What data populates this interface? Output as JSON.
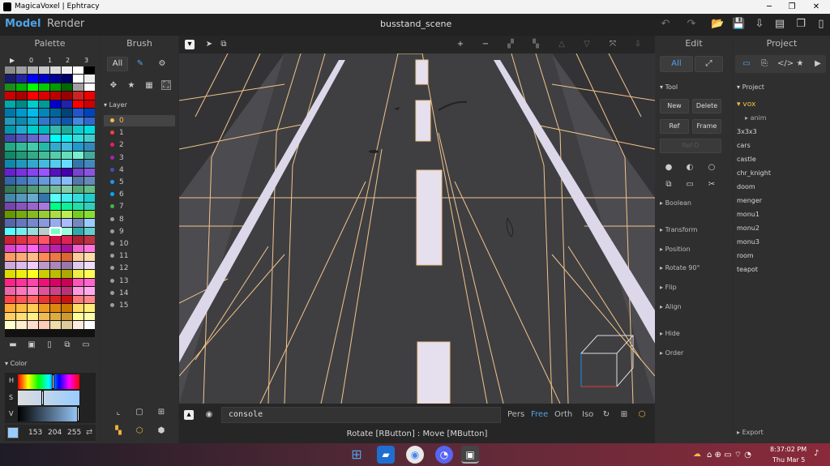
{
  "window": {
    "title": "MagicaVoxel | Ephtracy",
    "minimize": "─",
    "maximize": "❐",
    "close": "✕"
  },
  "menubar": {
    "model": "Model",
    "render": "Render",
    "scene_title": "busstand_scene",
    "icons": [
      "undo-icon",
      "redo-icon",
      "open-folder-icon",
      "save-icon",
      "export-icon",
      "new-file-icon",
      "copy-file-icon",
      "file-icon"
    ]
  },
  "palette": {
    "title": "Palette",
    "play": "▶",
    "pages": [
      "0",
      "1",
      "2",
      "3"
    ],
    "colors": [
      "#8c8c8c",
      "#a0a0a0",
      "#b4b4b4",
      "#c8c8c8",
      "#dcdcdc",
      "#f0f0f0",
      "#ffffff",
      "#000000",
      "#1a1a6e",
      "#2323a0",
      "#0000ff",
      "#0000cc",
      "#000099",
      "#000066",
      "#ffffff",
      "#eeeeee",
      "#1a8c1a",
      "#00b400",
      "#00ff00",
      "#00cc00",
      "#009900",
      "#006600",
      "#a0a0a0",
      "#ffffff",
      "#cc0000",
      "#aa0000",
      "#ff0000",
      "#dd0000",
      "#bb0000",
      "#990000",
      "#cc2222",
      "#ee0000",
      "#00aaaa",
      "#008888",
      "#00cccc",
      "#009999",
      "#0000cc",
      "#2222aa",
      "#ff0000",
      "#cc0000",
      "#0077aa",
      "#0099cc",
      "#00bbee",
      "#0088bb",
      "#006699",
      "#004477",
      "#2255cc",
      "#0044bb",
      "#2299bb",
      "#1188aa",
      "#11aacc",
      "#3377cc",
      "#2266bb",
      "#1155aa",
      "#4488dd",
      "#3366cc",
      "#0099aa",
      "#22aacc",
      "#00cccc",
      "#00bbbb",
      "#33bbaa",
      "#22aa99",
      "#11cccc",
      "#00dddd",
      "#4444aa",
      "#5555bb",
      "#6666cc",
      "#7777dd",
      "#00ffff",
      "#11eeee",
      "#33dddd",
      "#44cccc",
      "#22aa88",
      "#33bb99",
      "#44ccaa",
      "#22bbaa",
      "#33aacc",
      "#44bbdd",
      "#2299cc",
      "#3388bb",
      "#118866",
      "#229977",
      "#33aa88",
      "#44bb99",
      "#55ccaa",
      "#66ddbb",
      "#77eecc",
      "#44aa99",
      "#1188aa",
      "#2299bb",
      "#33aacc",
      "#44bbdd",
      "#55ccee",
      "#66ddff",
      "#3377aa",
      "#4488bb",
      "#6622cc",
      "#7733dd",
      "#8844ee",
      "#9955ff",
      "#5511bb",
      "#4400aa",
      "#7744cc",
      "#8855dd",
      "#3366aa",
      "#4477bb",
      "#5588cc",
      "#6699dd",
      "#77aaee",
      "#88bbff",
      "#5577aa",
      "#6688bb",
      "#337755",
      "#448866",
      "#559977",
      "#66aa88",
      "#77bb99",
      "#88ccaa",
      "#55aa77",
      "#66bb88",
      "#4488aa",
      "#5599bb",
      "#66aacc",
      "#3377aa",
      "#55ffff",
      "#44eeee",
      "#33dddd",
      "#22cccc",
      "#7744aa",
      "#8855bb",
      "#9966cc",
      "#aa77dd",
      "#00ff88",
      "#11ee99",
      "#22ddaa",
      "#33ccbb",
      "#669900",
      "#77aa11",
      "#88bb22",
      "#99cc33",
      "#aadd44",
      "#bbee55",
      "#77cc22",
      "#88dd33",
      "#5566aa",
      "#6677bb",
      "#7788cc",
      "#8899dd",
      "#99aaee",
      "#aabbff",
      "#7788bb",
      "#99ccff",
      "#55ffff",
      "#77eeee",
      "#99dddd",
      "#bbcccc",
      "#77ffcc",
      "#99ffdd",
      "#33aaaa",
      "#66cccc",
      "#cc2233",
      "#dd3344",
      "#ee4455",
      "#ff5566",
      "#cc1144",
      "#dd2255",
      "#aa2233",
      "#bb3344",
      "#dd44cc",
      "#ee55dd",
      "#ff66ee",
      "#cc33bb",
      "#bb22aa",
      "#aa1199",
      "#ee66cc",
      "#ff77dd",
      "#ff9966",
      "#ffaa77",
      "#ffbb88",
      "#ff8855",
      "#ee7744",
      "#dd6633",
      "#ffcc99",
      "#ffddaa",
      "#ccaadd",
      "#ddbbee",
      "#eeccff",
      "#bb99cc",
      "#aa88bb",
      "#9977aa",
      "#ddccee",
      "#eeddff",
      "#dddd00",
      "#eeee11",
      "#ffff22",
      "#cccc00",
      "#bbbb00",
      "#aaaa00",
      "#eeee44",
      "#ffff55",
      "#ff2288",
      "#ff3399",
      "#ff44aa",
      "#ee1177",
      "#dd0066",
      "#cc0055",
      "#ff55bb",
      "#ff66cc",
      "#ee66aa",
      "#ff77bb",
      "#ff88cc",
      "#dd5599",
      "#cc4488",
      "#bb3377",
      "#ff99dd",
      "#ffaaee",
      "#ff4444",
      "#ff5555",
      "#ff6666",
      "#ee3333",
      "#dd2222",
      "#cc1111",
      "#ff7777",
      "#ff8888",
      "#ffaa33",
      "#ffbb44",
      "#ffcc55",
      "#ee9922",
      "#dd8811",
      "#cc7700",
      "#ffdd66",
      "#ffee77",
      "#ffcc66",
      "#ffdd77",
      "#ffee88",
      "#eebb55",
      "#ddaa44",
      "#cc9933",
      "#ffff99",
      "#ffffaa",
      "#ffffcc",
      "#ffeecc",
      "#ffddcc",
      "#ffccbb",
      "#eeddaa",
      "#ddcc99",
      "#ffeedd",
      "#ffffff"
    ],
    "selected_index": 156,
    "color_section": "Color",
    "h_label": "H",
    "s_label": "S",
    "v_label": "V",
    "h_value": 0.58,
    "s_value": 0.4,
    "v_value": 1.0,
    "rgb": [
      "153",
      "204",
      "255"
    ],
    "swap": "⇄"
  },
  "brush": {
    "title": "Brush",
    "all": "All",
    "layer_header": "Layer",
    "layers": [
      {
        "label": "0",
        "color": "#ffb74d"
      },
      {
        "label": "1",
        "color": "#f44336"
      },
      {
        "label": "2",
        "color": "#e91e63"
      },
      {
        "label": "3",
        "color": "#9c27b0"
      },
      {
        "label": "4",
        "color": "#3f51b5"
      },
      {
        "label": "5",
        "color": "#2196f3"
      },
      {
        "label": "6",
        "color": "#03a9f4"
      },
      {
        "label": "7",
        "color": "#4caf50"
      },
      {
        "label": "8",
        "color": "#9e9e9e"
      },
      {
        "label": "9",
        "color": "#9e9e9e"
      },
      {
        "label": "10",
        "color": "#9e9e9e"
      },
      {
        "label": "11",
        "color": "#9e9e9e"
      },
      {
        "label": "12",
        "color": "#9e9e9e"
      },
      {
        "label": "13",
        "color": "#9e9e9e"
      },
      {
        "label": "14",
        "color": "#9e9e9e"
      },
      {
        "label": "15",
        "color": "#9e9e9e"
      }
    ]
  },
  "viewport": {
    "console_text": "console",
    "view_modes": [
      "Pers",
      "Free",
      "Orth",
      "Iso"
    ],
    "active_mode": "Free",
    "status": "Rotate [RButton] : Move [MButton]"
  },
  "edit": {
    "title": "Edit",
    "all": "All",
    "tool_header": "Tool",
    "buttons": [
      "New",
      "Delete",
      "Ref",
      "Frame"
    ],
    "ref_d": "Ref-D",
    "sections": [
      "Boolean",
      "Transform",
      "Position",
      "Rotate 90°",
      "Flip",
      "Align",
      "Hide",
      "Order"
    ]
  },
  "project": {
    "title": "Project",
    "header": "Project",
    "folder": "vox",
    "subfolder": "anim",
    "items": [
      "3x3x3",
      "cars",
      "castle",
      "chr_knight",
      "doom",
      "menger",
      "monu1",
      "monu2",
      "monu3",
      "room",
      "teapot"
    ],
    "export": "Export"
  },
  "taskbar": {
    "time": "8:37:02 PM",
    "date": "Thu Mar 5"
  },
  "colors": {
    "accent": "#4fa3e8",
    "active_layer": "#ffb74d",
    "viewport_bg": "#4a4a4e",
    "wire": "#f2c48a"
  }
}
